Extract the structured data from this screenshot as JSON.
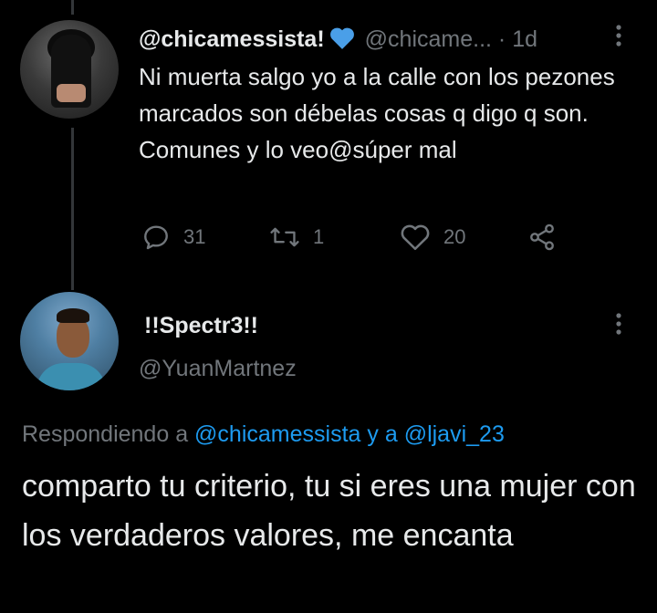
{
  "tweet": {
    "display_name": "@chicamessista!",
    "handle": "@chicame...",
    "separator": "·",
    "time": "1d",
    "text": "Ni muerta salgo yo a la calle con los pezones marcados son débelas cosas q digo q son. Comunes y lo veo@súper mal",
    "replies": "31",
    "retweets": "1",
    "likes": "20",
    "icons": [
      "blue-heart-icon",
      "reply-icon",
      "retweet-icon",
      "like-icon",
      "share-icon",
      "more-icon"
    ],
    "colors": {
      "accent": "#1d9bf0",
      "muted": "#71767b",
      "text": "#e7e9ea",
      "background": "#000000"
    }
  },
  "reply": {
    "display_name": "!!Spectr3!!",
    "handle": "@YuanMartnez",
    "replying_prefix": "Respondiendo a",
    "replying_to_1": "@chicamessista",
    "replying_and": "y a",
    "replying_to_2": "@ljavi_23",
    "text": "comparto tu criterio, tu si eres una mujer con los verdaderos valores, me encanta"
  }
}
